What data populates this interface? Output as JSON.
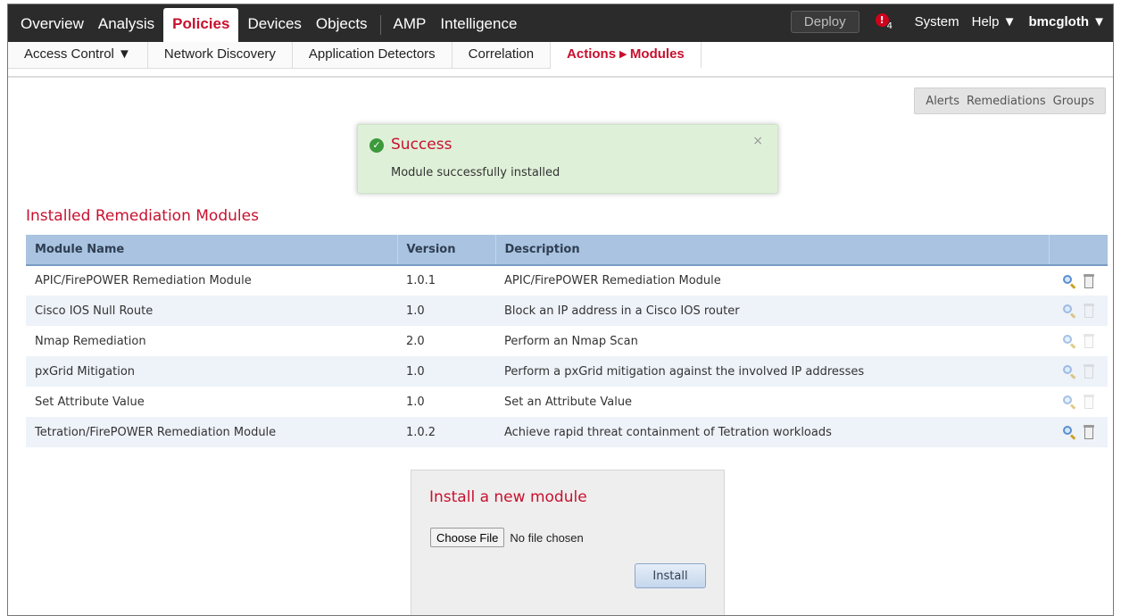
{
  "topnav": {
    "items": [
      "Overview",
      "Analysis",
      "Policies",
      "Devices",
      "Objects",
      "AMP",
      "Intelligence"
    ],
    "active": "Policies",
    "deploy_label": "Deploy",
    "alert_icon": "!",
    "alert_count": "4",
    "system_label": "System",
    "help_label": "Help ▼",
    "user_label": "bmcgloth ▼"
  },
  "subnav": {
    "items": [
      "Access Control ▼",
      "Network Discovery",
      "Application Detectors",
      "Correlation",
      "Actions ▸ Modules"
    ],
    "active": "Actions ▸ Modules"
  },
  "secondary_tabs": [
    "Alerts",
    "Remediations",
    "Groups"
  ],
  "success": {
    "title": "Success",
    "message": "Module successfully installed",
    "close": "×"
  },
  "section_title": "Installed Remediation Modules",
  "table": {
    "headers": [
      "Module Name",
      "Version",
      "Description",
      ""
    ],
    "rows": [
      {
        "name": "APIC/FirePOWER Remediation Module",
        "version": "1.0.1",
        "description": "APIC/FirePOWER Remediation Module",
        "deletable": true
      },
      {
        "name": "Cisco IOS Null Route",
        "version": "1.0",
        "description": "Block an IP address in a Cisco IOS router",
        "deletable": false
      },
      {
        "name": "Nmap Remediation",
        "version": "2.0",
        "description": "Perform an Nmap Scan",
        "deletable": false
      },
      {
        "name": "pxGrid Mitigation",
        "version": "1.0",
        "description": "Perform a pxGrid mitigation against the involved IP addresses",
        "deletable": false
      },
      {
        "name": "Set Attribute Value",
        "version": "1.0",
        "description": "Set an Attribute Value",
        "deletable": false
      },
      {
        "name": "Tetration/FirePOWER Remediation Module",
        "version": "1.0.2",
        "description": "Achieve rapid threat containment of Tetration workloads",
        "deletable": true
      }
    ]
  },
  "install": {
    "title": "Install a new module",
    "choose_file_label": "Choose File",
    "no_file_label": "No file chosen",
    "install_label": "Install"
  }
}
